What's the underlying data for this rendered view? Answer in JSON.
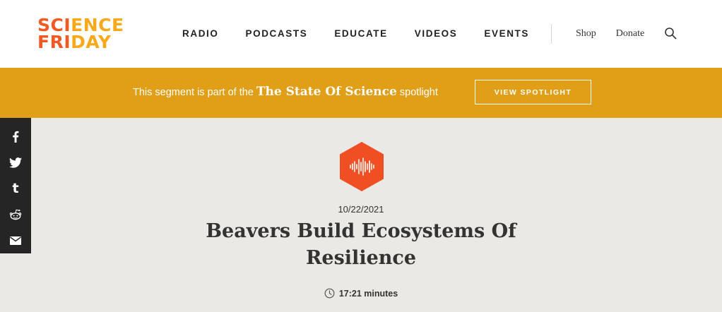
{
  "logo": {
    "line1_a": "SCI",
    "line1_b": "ENCE",
    "line2_a": "FRI",
    "line2_b": "DAY"
  },
  "nav": {
    "items": [
      "RADIO",
      "PODCASTS",
      "EDUCATE",
      "VIDEOS",
      "EVENTS"
    ]
  },
  "utility": {
    "shop": "Shop",
    "donate": "Donate",
    "search_icon": "search-icon"
  },
  "banner": {
    "prefix": "This segment is part of the",
    "spotlight_name": "The State Of Science",
    "suffix": "spotlight",
    "button": "VIEW SPOTLIGHT"
  },
  "share": {
    "icons": [
      "facebook-icon",
      "twitter-icon",
      "tumblr-icon",
      "reddit-icon",
      "email-icon"
    ],
    "tumblr_glyph": "t"
  },
  "article": {
    "date": "10/22/2021",
    "title": "Beavers Build Ecosystems Of Resilience",
    "duration": "17:21 minutes",
    "badge_icon": "audio-waveform-icon"
  },
  "colors": {
    "orange": "#f15a24",
    "yellow": "#f7a81b",
    "banner": "#e09f16",
    "sidebar": "#252525",
    "background": "#ebe9e5"
  }
}
